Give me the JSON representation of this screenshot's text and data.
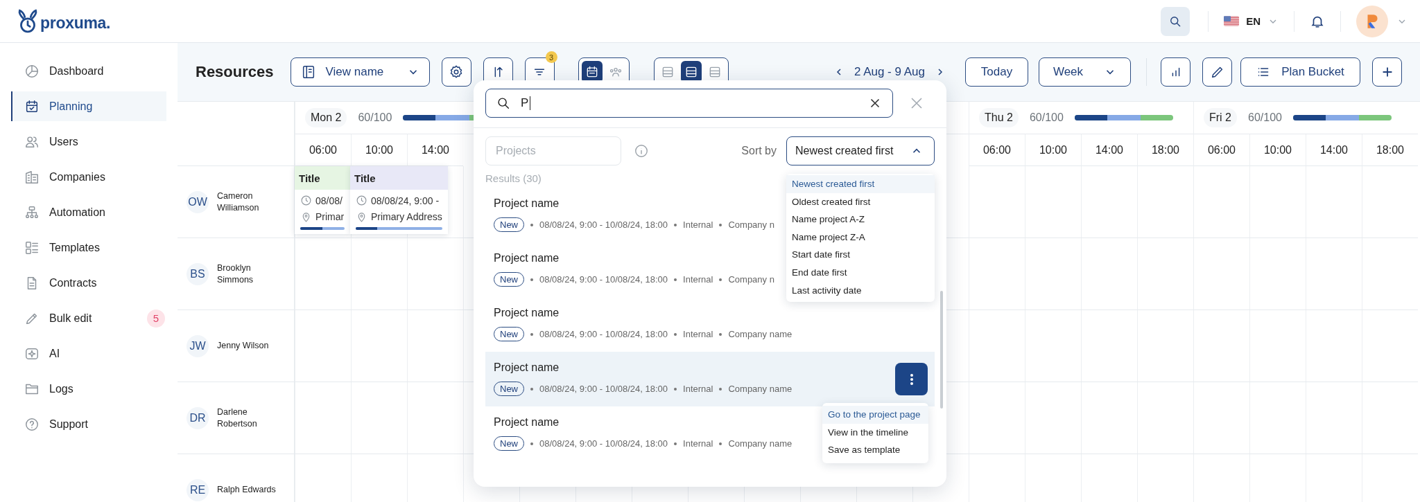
{
  "logo": {
    "text": "proxuma."
  },
  "header": {
    "language": "EN"
  },
  "sidebar": {
    "items": [
      {
        "label": "Dashboard",
        "selected": false
      },
      {
        "label": "Planning",
        "selected": true
      },
      {
        "label": "Users",
        "selected": false
      },
      {
        "label": "Companies",
        "selected": false
      },
      {
        "label": "Automation",
        "selected": false
      },
      {
        "label": "Templates",
        "selected": false
      },
      {
        "label": "Contracts",
        "selected": false
      },
      {
        "label": "Bulk edit",
        "selected": false,
        "badge": "5"
      },
      {
        "label": "AI",
        "selected": false
      },
      {
        "label": "Logs",
        "selected": false
      },
      {
        "label": "Support",
        "selected": false
      }
    ]
  },
  "toolbar": {
    "title": "Resources",
    "view": "View name",
    "filter_count": "3",
    "mode_toggle": [
      {
        "selected": true
      },
      {
        "selected": false
      }
    ],
    "density_toggle": [
      {
        "selected": false
      },
      {
        "selected": true
      },
      {
        "selected": false
      }
    ],
    "date_range": "2 Aug - 9 Aug",
    "today": "Today",
    "period": "Week",
    "plan_bucket": "Plan Bucket"
  },
  "calendar": {
    "days": [
      {
        "label": "Mon 2",
        "load": "60/100",
        "segments": [
          {
            "level": 1,
            "color": "#7cc67c"
          },
          {
            "level": 0.67,
            "color": "#86a9e6"
          },
          {
            "level": 0.33,
            "color": "#1c4587"
          }
        ],
        "hours": [
          "06:00",
          "10:00",
          "14:00"
        ]
      },
      {
        "label": "Thu 2",
        "load": "60/100",
        "segments": [
          {
            "level": 1,
            "color": "#7cc67c"
          },
          {
            "level": 0.67,
            "color": "#86a9e6"
          },
          {
            "level": 0.33,
            "color": "#1c4587"
          }
        ],
        "hours": [
          "06:00",
          "10:00",
          "14:00",
          "18:00"
        ]
      },
      {
        "label": "Fri 2",
        "load": "60/100",
        "segments": [
          {
            "level": 1,
            "color": "#7cc67c"
          },
          {
            "level": 0.67,
            "color": "#86a9e6"
          },
          {
            "level": 0.33,
            "color": "#1c4587"
          }
        ],
        "hours": [
          "06:00",
          "10:00",
          "14:00",
          "18:00"
        ]
      }
    ],
    "resources": [
      {
        "initials": "OW",
        "name": "Cameron Williamson",
        "events": [
          {
            "title": "Title",
            "color": "#e6f5e3",
            "time": "08/08/",
            "address": "Primar",
            "level": 0.5
          },
          {
            "title": "Title",
            "color": "#e8e8f7",
            "time": "08/08/24, 9:00 -",
            "address": "Primary Address",
            "level": 0.25
          }
        ]
      },
      {
        "initials": "BS",
        "name": "Brooklyn Simmons"
      },
      {
        "initials": "JW",
        "name": "Jenny Wilson"
      },
      {
        "initials": "DR",
        "name": "Darlene Robertson"
      },
      {
        "initials": "RE",
        "name": "Ralph Edwards"
      }
    ]
  },
  "search_popup": {
    "query": "P",
    "scope_placeholder": "Projects",
    "sort_label": "Sort by",
    "sort_value": "Newest created first",
    "sort_expanded": true,
    "sort_options": [
      {
        "label": "Newest created first",
        "selected": true
      },
      {
        "label": "Oldest created first",
        "selected": false
      },
      {
        "label": "Name project  A-Z",
        "selected": false
      },
      {
        "label": "Name project  Z-A",
        "selected": false
      },
      {
        "label": "Start date first",
        "selected": false
      },
      {
        "label": "End date first",
        "selected": false
      },
      {
        "label": "Last activity date",
        "selected": false
      }
    ],
    "results_label": "Results (30)",
    "results": [
      {
        "name": "Project name",
        "status": "New",
        "dates": "08/08/24, 9:00 - 10/08/24, 18:00",
        "type": "Internal",
        "company": "Company n",
        "hovered": false
      },
      {
        "name": "Project name",
        "status": "New",
        "dates": "08/08/24, 9:00 - 10/08/24, 18:00",
        "type": "Internal",
        "company": "Company n",
        "hovered": false
      },
      {
        "name": "Project name",
        "status": "New",
        "dates": "08/08/24, 9:00 - 10/08/24, 18:00",
        "type": "Internal",
        "company": "Company name",
        "hovered": false
      },
      {
        "name": "Project name",
        "status": "New",
        "dates": "08/08/24, 9:00 - 10/08/24, 18:00",
        "type": "Internal",
        "company": "Company name",
        "hovered": true,
        "menu": [
          {
            "label": "Go to the project page",
            "selected": true
          },
          {
            "label": "View in the timeline",
            "selected": false
          },
          {
            "label": "Save as template",
            "selected": false
          }
        ]
      },
      {
        "name": "Project name",
        "status": "New",
        "dates": "08/08/24, 9:00 - 10/08/24, 18:00",
        "type": "Internal",
        "company": "Company name",
        "hovered": false
      }
    ]
  }
}
